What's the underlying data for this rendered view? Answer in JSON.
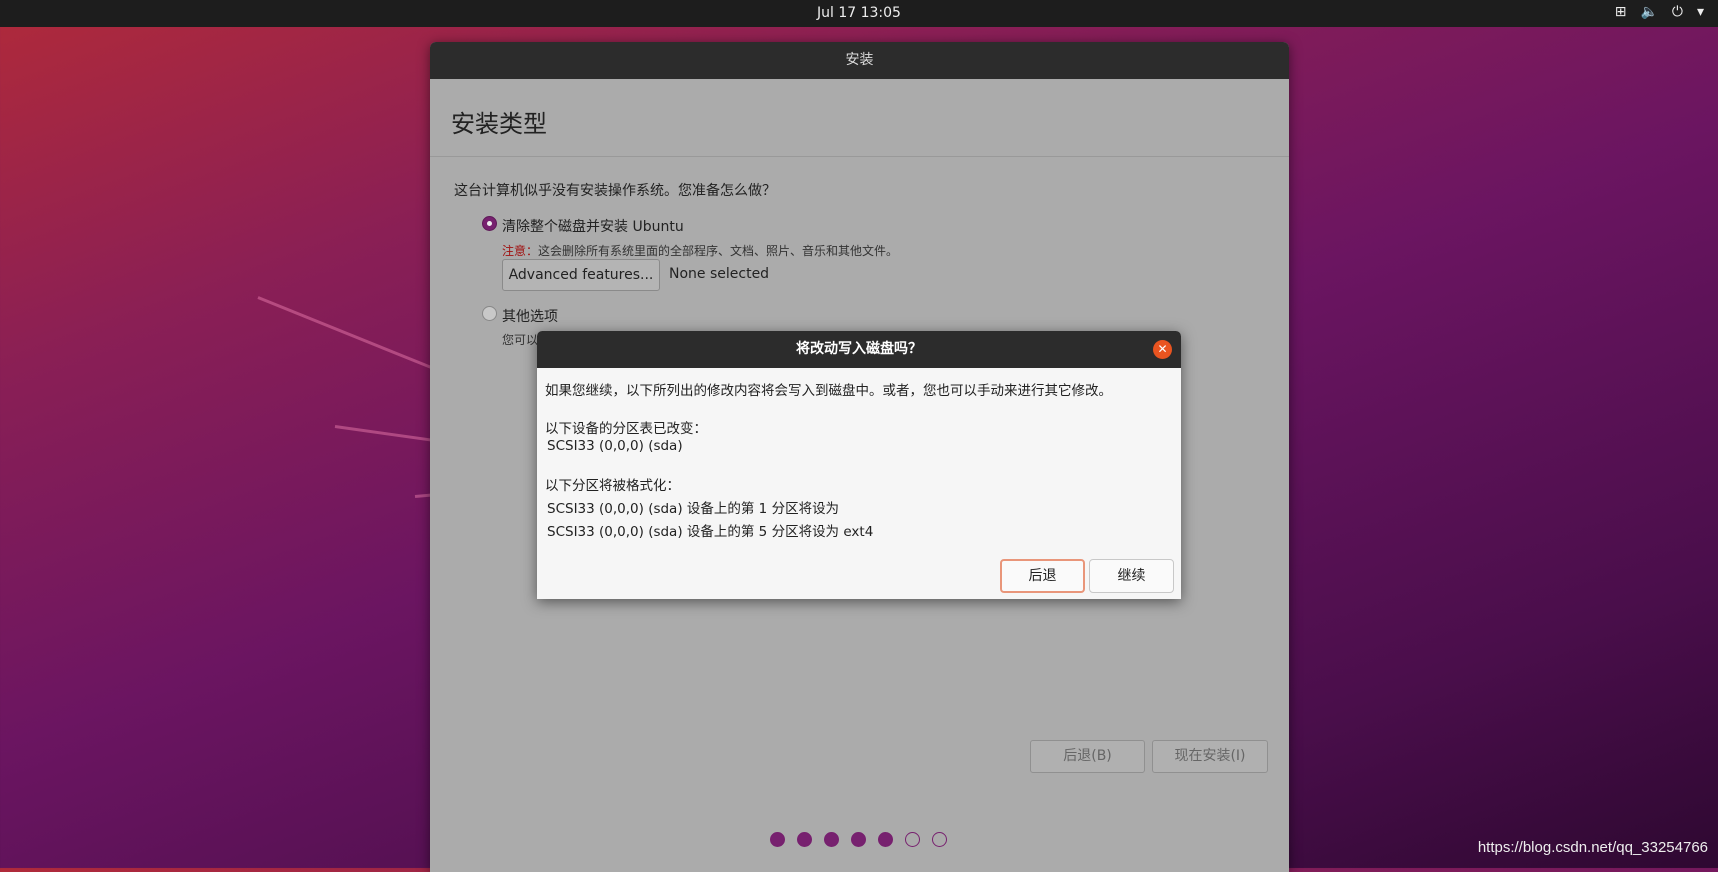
{
  "topbar": {
    "clock": "Jul 17  13:05"
  },
  "installer": {
    "title": "安装",
    "heading": "安装类型",
    "question": "这台计算机似乎没有安装操作系统。您准备怎么做？",
    "option1": "清除整个磁盘并安装 Ubuntu",
    "note_label": "注意：",
    "note_text": "这会删除所有系统里面的全部程序、文档、照片、音乐和其他文件。",
    "advanced_button": "Advanced features...",
    "advanced_value": "None selected",
    "option2": "其他选项",
    "option2_sub": "您可以",
    "back_button": "后退(B)",
    "install_button": "现在安装(I)",
    "progress": {
      "completed_steps": 5,
      "total_steps": 7
    }
  },
  "dialog": {
    "title": "将改动写入磁盘吗？",
    "intro": "如果您继续，以下所列出的修改内容将会写入到磁盘中。或者，您也可以手动来进行其它修改。",
    "partition_table_label": "以下设备的分区表已改变：",
    "partition_table_device": "SCSI33 (0,0,0) (sda)",
    "format_label": "以下分区将被格式化：",
    "format_items": [
      "SCSI33 (0,0,0) (sda) 设备上的第 1 分区将设为",
      "SCSI33 (0,0,0) (sda) 设备上的第 5 分区将设为 ext4"
    ],
    "back_button": "后退",
    "continue_button": "继续"
  },
  "watermark": "https://blog.csdn.net/qq_33254766"
}
